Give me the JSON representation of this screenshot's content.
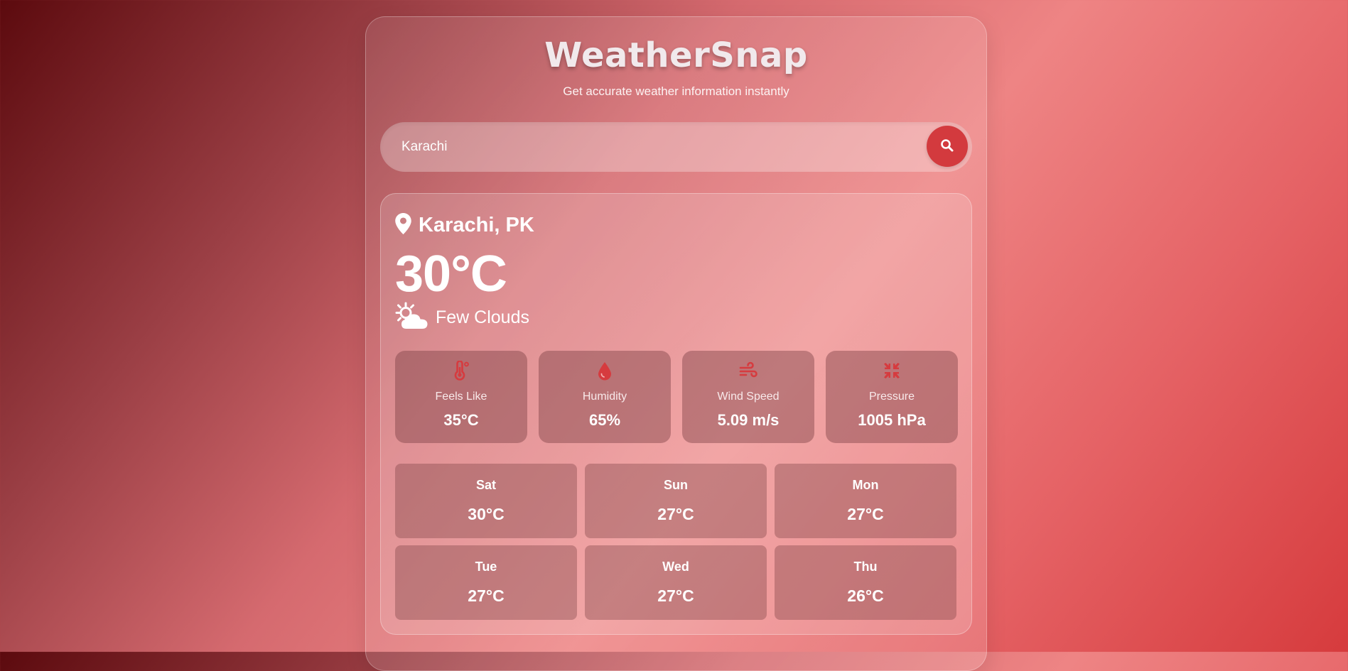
{
  "app": {
    "title": "WeatherSnap",
    "subtitle": "Get accurate weather information instantly"
  },
  "search": {
    "value": "Karachi",
    "button_icon": "search-icon"
  },
  "current": {
    "location": "Karachi, PK",
    "location_icon": "map-pin-icon",
    "temperature": "30°C",
    "condition": "Few Clouds",
    "condition_icon": "sun-behind-cloud-icon"
  },
  "details": [
    {
      "icon": "thermometer-icon",
      "label": "Feels Like",
      "value": "35°C"
    },
    {
      "icon": "droplet-icon",
      "label": "Humidity",
      "value": "65%"
    },
    {
      "icon": "wind-icon",
      "label": "Wind Speed",
      "value": "5.09 m/s"
    },
    {
      "icon": "compress-icon",
      "label": "Pressure",
      "value": "1005 hPa"
    }
  ],
  "forecast": [
    {
      "day": "Sat",
      "temp": "30°C"
    },
    {
      "day": "Sun",
      "temp": "27°C"
    },
    {
      "day": "Mon",
      "temp": "27°C"
    },
    {
      "day": "Tue",
      "temp": "27°C"
    },
    {
      "day": "Wed",
      "temp": "27°C"
    },
    {
      "day": "Thu",
      "temp": "26°C"
    }
  ],
  "colors": {
    "accent": "#d33a3e",
    "icon": "#d63b3f",
    "text": "#ffffff"
  }
}
